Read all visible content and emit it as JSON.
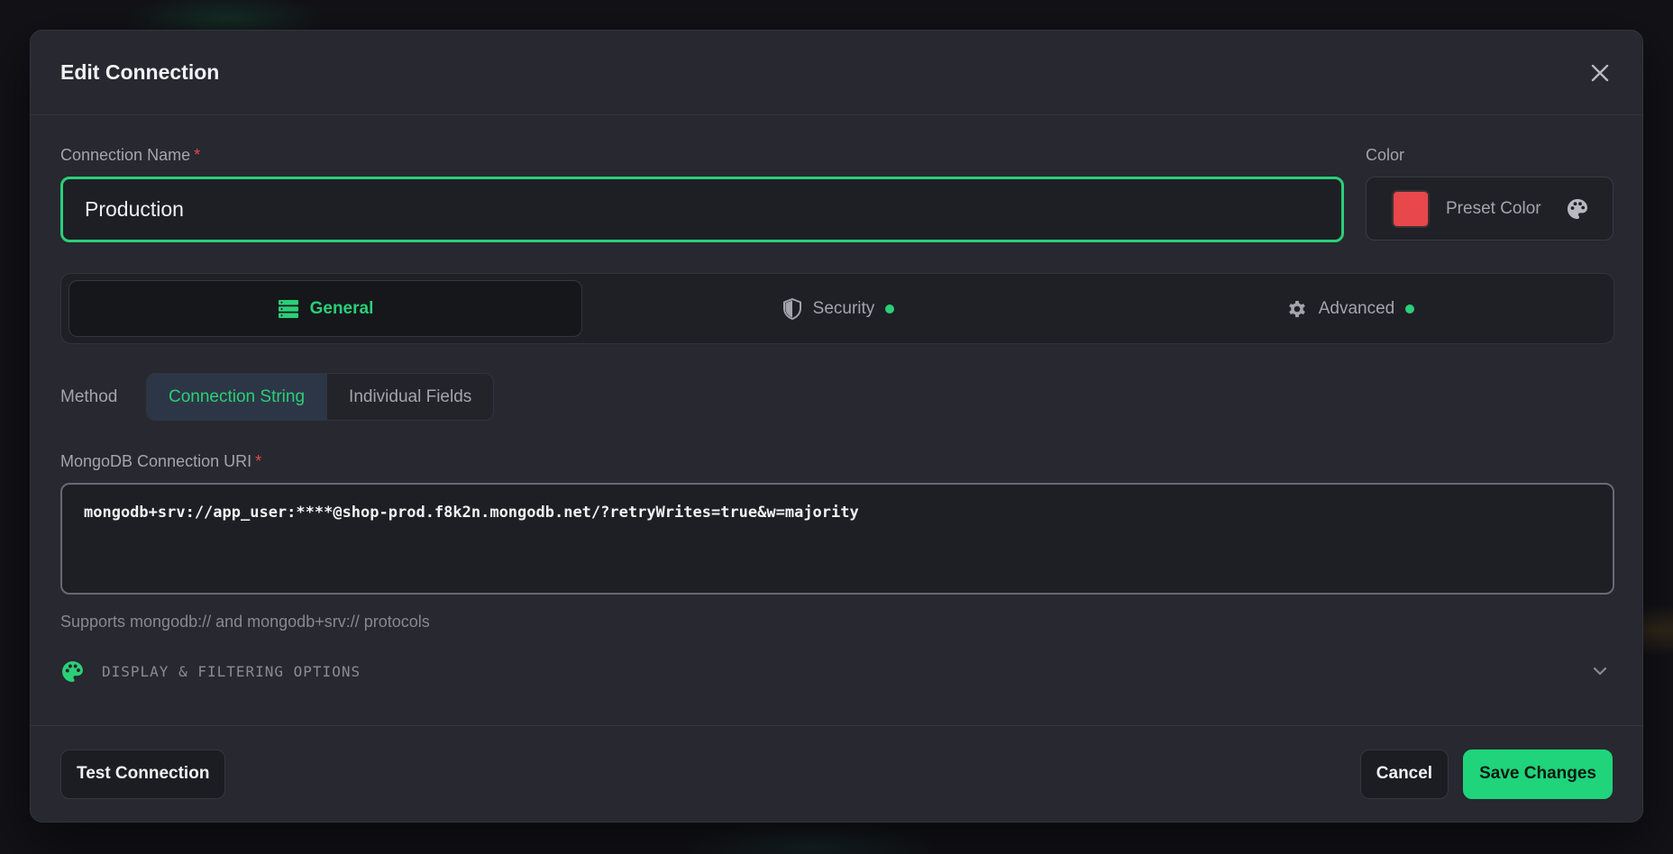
{
  "dialog": {
    "title": "Edit Connection"
  },
  "connection_name": {
    "label": "Connection Name",
    "required_mark": "*",
    "value": "Production"
  },
  "color": {
    "label": "Color",
    "preset_label": "Preset Color",
    "swatch_color": "#e8474b"
  },
  "tabs": [
    {
      "label": "General",
      "icon": "server-stack-icon",
      "active": true
    },
    {
      "label": "Security",
      "icon": "shield-icon",
      "status_dot": true
    },
    {
      "label": "Advanced",
      "icon": "gear-icon",
      "status_dot": true
    }
  ],
  "method": {
    "label": "Method",
    "options": [
      "Connection String",
      "Individual Fields"
    ],
    "selected": "Connection String"
  },
  "uri": {
    "label": "MongoDB Connection URI",
    "required_mark": "*",
    "value": "mongodb+srv://app_user:****@shop-prod.f8k2n.mongodb.net/?retryWrites=true&w=majority",
    "hint": "Supports mongodb:// and mongodb+srv:// protocols"
  },
  "display_options": {
    "label": "DISPLAY & FILTERING OPTIONS",
    "icon": "palette-icon",
    "expanded": false
  },
  "footer": {
    "test_label": "Test Connection",
    "cancel_label": "Cancel",
    "save_label": "Save Changes"
  },
  "colors": {
    "accent": "#2bcf78",
    "primary_button": "#1fd47a",
    "required": "#e5484d",
    "surface": "#272830"
  }
}
